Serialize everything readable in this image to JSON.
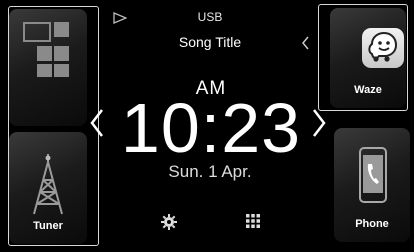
{
  "header": {
    "source_label": "USB",
    "song_title": "Song Title"
  },
  "clock": {
    "ampm": "AM",
    "time": "10:23",
    "date": "Sun.   1 Apr."
  },
  "left_tiles": [
    {
      "label": "",
      "icon": "grid-icon"
    },
    {
      "label": "Tuner",
      "icon": "radio-tower-icon"
    }
  ],
  "right_tiles": [
    {
      "label": "Waze",
      "icon": "waze-icon"
    },
    {
      "label": "Phone",
      "icon": "phone-icon"
    }
  ],
  "bottom_bar": {
    "settings_icon": "gear-icon",
    "apps_icon": "apps-grid-icon"
  },
  "colors": {
    "background": "#000000",
    "tile_frame": "#d8d8d8",
    "waze_badge": "#e6e6e6",
    "icon_gray": "#8a8a8a"
  }
}
